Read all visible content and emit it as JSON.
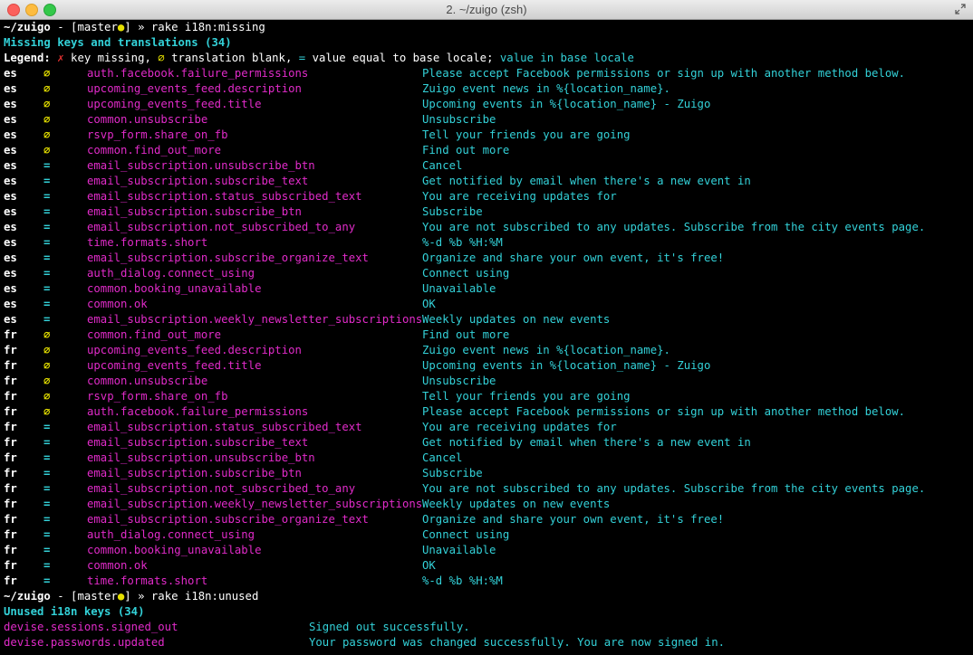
{
  "window": {
    "title": "2. ~/zuigo (zsh)"
  },
  "colors": {
    "background": "#000000",
    "text": "#ffffff",
    "cyan": "#33d1d8",
    "magenta": "#e12bc9",
    "yellow": "#e5e000",
    "red": "#e03030"
  },
  "prompt1": {
    "dir": "~/zuigo",
    "branch_open": " - [master",
    "dot": "●",
    "branch_close": "] » ",
    "command": "rake i18n:missing"
  },
  "missing_header": "Missing keys and translations (34)",
  "legend": {
    "label": "Legend: ",
    "x_mark": "✗",
    "x_text": " key missing, ",
    "blank_mark": "∅",
    "blank_text": " translation blank, ",
    "eq_mark": "=",
    "eq_text": " value equal to base locale; ",
    "base_text": "value in base locale"
  },
  "missing_rows": [
    {
      "locale": "es",
      "mark": "∅",
      "key": "auth.facebook.failure_permissions",
      "value": "Please accept Facebook permissions or sign up with another method below."
    },
    {
      "locale": "es",
      "mark": "∅",
      "key": "upcoming_events_feed.description",
      "value": "Zuigo event news in %{location_name}."
    },
    {
      "locale": "es",
      "mark": "∅",
      "key": "upcoming_events_feed.title",
      "value": "Upcoming events in %{location_name} - Zuigo"
    },
    {
      "locale": "es",
      "mark": "∅",
      "key": "common.unsubscribe",
      "value": "Unsubscribe"
    },
    {
      "locale": "es",
      "mark": "∅",
      "key": "rsvp_form.share_on_fb",
      "value": "Tell your friends you are going"
    },
    {
      "locale": "es",
      "mark": "∅",
      "key": "common.find_out_more",
      "value": "Find out more"
    },
    {
      "locale": "es",
      "mark": "=",
      "key": "email_subscription.unsubscribe_btn",
      "value": "Cancel"
    },
    {
      "locale": "es",
      "mark": "=",
      "key": "email_subscription.subscribe_text",
      "value": "Get notified by email when there's a new event in"
    },
    {
      "locale": "es",
      "mark": "=",
      "key": "email_subscription.status_subscribed_text",
      "value": "You are receiving updates for"
    },
    {
      "locale": "es",
      "mark": "=",
      "key": "email_subscription.subscribe_btn",
      "value": "Subscribe"
    },
    {
      "locale": "es",
      "mark": "=",
      "key": "email_subscription.not_subscribed_to_any",
      "value": "You are not subscribed to any updates. Subscribe from the city events page."
    },
    {
      "locale": "es",
      "mark": "=",
      "key": "time.formats.short",
      "value": "%-d %b %H:%M"
    },
    {
      "locale": "es",
      "mark": "=",
      "key": "email_subscription.subscribe_organize_text",
      "value": "Organize and share your own event, it's free!"
    },
    {
      "locale": "es",
      "mark": "=",
      "key": "auth_dialog.connect_using",
      "value": "Connect using"
    },
    {
      "locale": "es",
      "mark": "=",
      "key": "common.booking_unavailable",
      "value": "Unavailable"
    },
    {
      "locale": "es",
      "mark": "=",
      "key": "common.ok",
      "value": "OK"
    },
    {
      "locale": "es",
      "mark": "=",
      "key": "email_subscription.weekly_newsletter_subscriptions",
      "value": "Weekly updates on new events"
    },
    {
      "locale": "fr",
      "mark": "∅",
      "key": "common.find_out_more",
      "value": "Find out more"
    },
    {
      "locale": "fr",
      "mark": "∅",
      "key": "upcoming_events_feed.description",
      "value": "Zuigo event news in %{location_name}."
    },
    {
      "locale": "fr",
      "mark": "∅",
      "key": "upcoming_events_feed.title",
      "value": "Upcoming events in %{location_name} - Zuigo"
    },
    {
      "locale": "fr",
      "mark": "∅",
      "key": "common.unsubscribe",
      "value": "Unsubscribe"
    },
    {
      "locale": "fr",
      "mark": "∅",
      "key": "rsvp_form.share_on_fb",
      "value": "Tell your friends you are going"
    },
    {
      "locale": "fr",
      "mark": "∅",
      "key": "auth.facebook.failure_permissions",
      "value": "Please accept Facebook permissions or sign up with another method below."
    },
    {
      "locale": "fr",
      "mark": "=",
      "key": "email_subscription.status_subscribed_text",
      "value": "You are receiving updates for"
    },
    {
      "locale": "fr",
      "mark": "=",
      "key": "email_subscription.subscribe_text",
      "value": "Get notified by email when there's a new event in"
    },
    {
      "locale": "fr",
      "mark": "=",
      "key": "email_subscription.unsubscribe_btn",
      "value": "Cancel"
    },
    {
      "locale": "fr",
      "mark": "=",
      "key": "email_subscription.subscribe_btn",
      "value": "Subscribe"
    },
    {
      "locale": "fr",
      "mark": "=",
      "key": "email_subscription.not_subscribed_to_any",
      "value": "You are not subscribed to any updates. Subscribe from the city events page."
    },
    {
      "locale": "fr",
      "mark": "=",
      "key": "email_subscription.weekly_newsletter_subscriptions",
      "value": "Weekly updates on new events"
    },
    {
      "locale": "fr",
      "mark": "=",
      "key": "email_subscription.subscribe_organize_text",
      "value": "Organize and share your own event, it's free!"
    },
    {
      "locale": "fr",
      "mark": "=",
      "key": "auth_dialog.connect_using",
      "value": "Connect using"
    },
    {
      "locale": "fr",
      "mark": "=",
      "key": "common.booking_unavailable",
      "value": "Unavailable"
    },
    {
      "locale": "fr",
      "mark": "=",
      "key": "common.ok",
      "value": "OK"
    },
    {
      "locale": "fr",
      "mark": "=",
      "key": "time.formats.short",
      "value": "%-d %b %H:%M"
    }
  ],
  "prompt2": {
    "dir": "~/zuigo",
    "branch_open": " - [master",
    "dot": "●",
    "branch_close": "] » ",
    "command": "rake i18n:unused"
  },
  "unused_header": "Unused i18n keys (34)",
  "unused_rows": [
    {
      "key": "devise.sessions.signed_out",
      "value": "Signed out successfully."
    },
    {
      "key": "devise.passwords.updated",
      "value": "Your password was changed successfully. You are now signed in."
    }
  ]
}
